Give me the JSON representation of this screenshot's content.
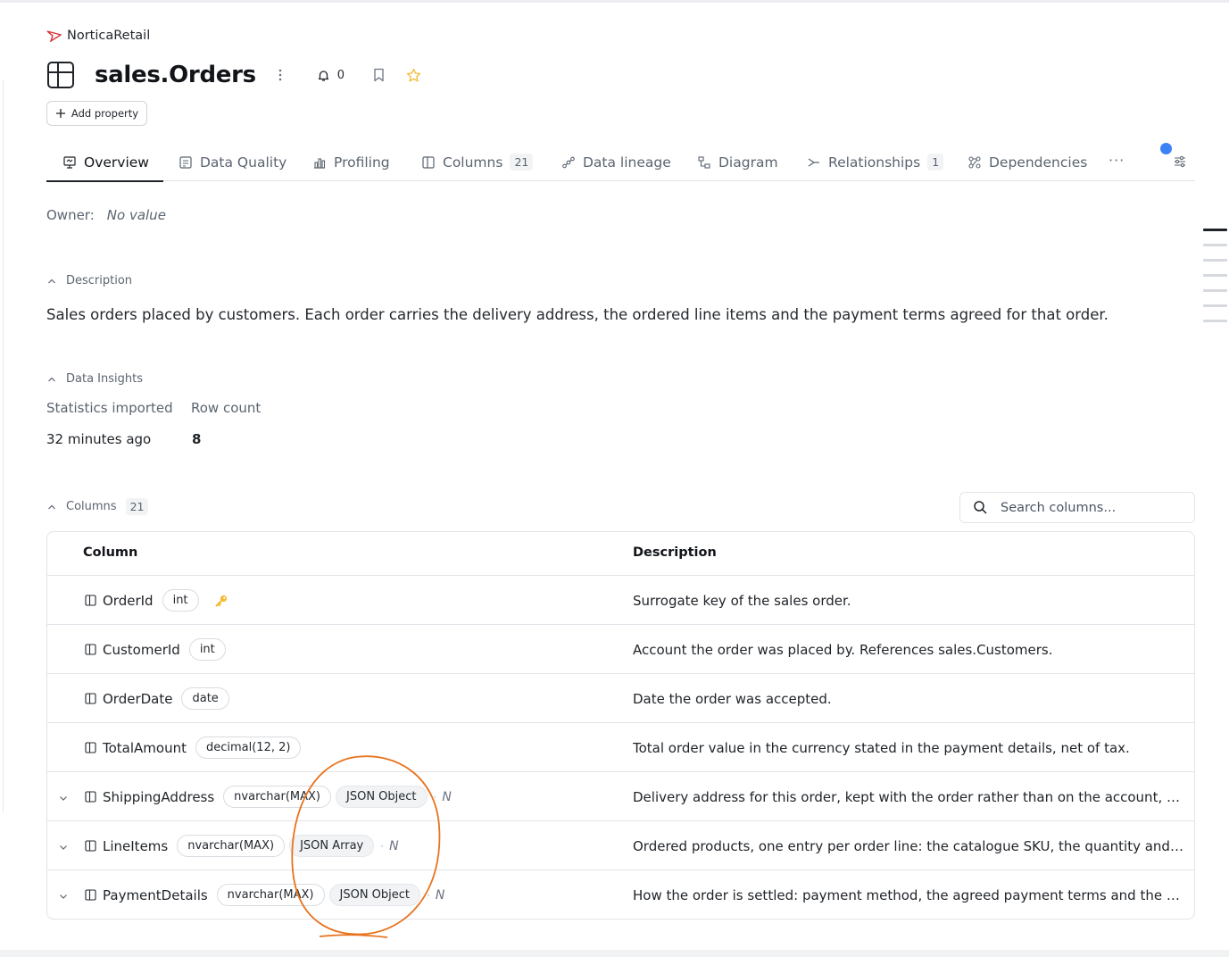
{
  "breadcrumb": {
    "label": "NorticaRetail"
  },
  "header": {
    "title": "sales.Orders",
    "notifications_count": "0",
    "add_property_label": "Add property"
  },
  "tabs": [
    {
      "label": "Overview",
      "icon": "overview-icon"
    },
    {
      "label": "Data Quality",
      "icon": "data-quality-icon"
    },
    {
      "label": "Profiling",
      "icon": "profiling-icon"
    },
    {
      "label": "Columns",
      "count": "21",
      "icon": "columns-icon"
    },
    {
      "label": "Data lineage",
      "icon": "lineage-icon"
    },
    {
      "label": "Diagram",
      "icon": "diagram-icon"
    },
    {
      "label": "Relationships",
      "count": "1",
      "icon": "relationships-icon"
    },
    {
      "label": "Dependencies",
      "icon": "dependencies-icon"
    }
  ],
  "tabs_more": "···",
  "owner": {
    "label": "Owner:",
    "value": "No value"
  },
  "description": {
    "heading": "Description",
    "text": "Sales orders placed by customers. Each order carries the delivery address, the ordered line items and the payment terms agreed for that order."
  },
  "insights": {
    "heading": "Data Insights",
    "stats_label": "Statistics imported",
    "stats_value": "32 minutes ago",
    "rowcount_label": "Row count",
    "rowcount_value": "8"
  },
  "columns_section": {
    "heading": "Columns",
    "count": "21",
    "search_placeholder": "Search columns...",
    "header_column": "Column",
    "header_description": "Description"
  },
  "rows": [
    {
      "name": "OrderId",
      "type": "int",
      "json": "",
      "nullable": "",
      "key": true,
      "expandable": false,
      "description": "Surrogate key of the sales order."
    },
    {
      "name": "CustomerId",
      "type": "int",
      "json": "",
      "nullable": "",
      "key": false,
      "expandable": false,
      "description": "Account the order was placed by. References sales.Customers."
    },
    {
      "name": "OrderDate",
      "type": "date",
      "json": "",
      "nullable": "",
      "key": false,
      "expandable": false,
      "description": "Date the order was accepted."
    },
    {
      "name": "TotalAmount",
      "type": "decimal(12, 2)",
      "json": "",
      "nullable": "",
      "key": false,
      "expandable": false,
      "description": "Total order value in the currency stated in the payment details, net of tax."
    },
    {
      "name": "ShippingAddress",
      "type": "nvarchar(MAX)",
      "json": "JSON Object",
      "nullable": "N",
      "key": false,
      "expandable": true,
      "description": "Delivery address for this order, kept with the order rather than on the account, bec..."
    },
    {
      "name": "LineItems",
      "type": "nvarchar(MAX)",
      "json": "JSON Array",
      "nullable": "N",
      "key": false,
      "expandable": true,
      "description": "Ordered products, one entry per order line: the catalogue SKU, the quantity and th..."
    },
    {
      "name": "PaymentDetails",
      "type": "nvarchar(MAX)",
      "json": "JSON Object",
      "nullable": "N",
      "key": false,
      "expandable": true,
      "description": "How the order is settled: payment method, the agreed payment terms and the curr..."
    }
  ],
  "colors": {
    "accent_dot": "#3b82f6",
    "key_icon": "#f5b933",
    "annotation": "#e8731e",
    "star": "#f5b933"
  }
}
